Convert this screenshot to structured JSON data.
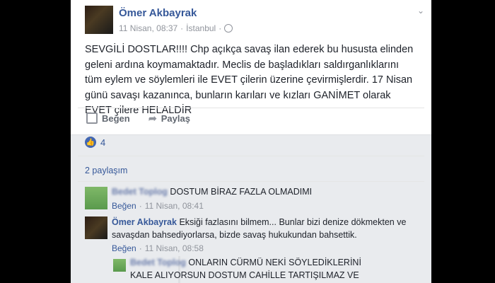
{
  "post": {
    "author": "Ömer Akbayrak",
    "date": "11 Nisan, 08:37",
    "separator": "·",
    "location": "İstanbul",
    "separator2": "·",
    "text": "SEVGİLİ DOSTLAR!!!! Chp açıkça savaş ilan ederek bu hususta elinden geleni ardına koymamaktadır. Meclis de başladıkları saldırganlıklarını tüm eylem ve söylemleri ile EVET çilerin üzerine çevirmişlerdir. 17 Nisan günü savaşı kazanınca, bunların karıları ve kızları GANİMET olarak EVET çilere HELALDİR",
    "like_label": "Beğen",
    "share_label": "Paylaş",
    "like_count": "4",
    "shares_label": "2 paylaşım",
    "icons": {
      "menu": "chevron-down-icon",
      "privacy": "globe-icon",
      "like": "thumbs-up-icon",
      "share": "share-arrow-icon"
    },
    "colors": {
      "link": "#365899",
      "like_badge": "#4267b2"
    }
  },
  "comments": [
    {
      "author": "Bedet Toplog",
      "text": "DOSTUM BİRAZ FAZLA OLMADIMI",
      "like_label": "Beğen",
      "separator": "·",
      "date": "11 Nisan, 08:41"
    },
    {
      "author": "Ömer Akbayrak",
      "text": "Eksiği fazlasını bilmem... Bunlar bizi denize dökmekten ve savaşdan bahsediyorlarsa, bizde savaş hukukundan bahsettik.",
      "like_label": "Beğen",
      "separator": "·",
      "date": "11 Nisan, 08:58"
    }
  ],
  "reply": {
    "author": "Bedet Toplog",
    "text": "ONLARIN CÜRMÜ NEKİ SÖYLEDİKLERİNİ KALE ALIYORSUN DOSTUM CAHİLLE TARTIŞILMAZ VE ONLAR ADAM"
  }
}
